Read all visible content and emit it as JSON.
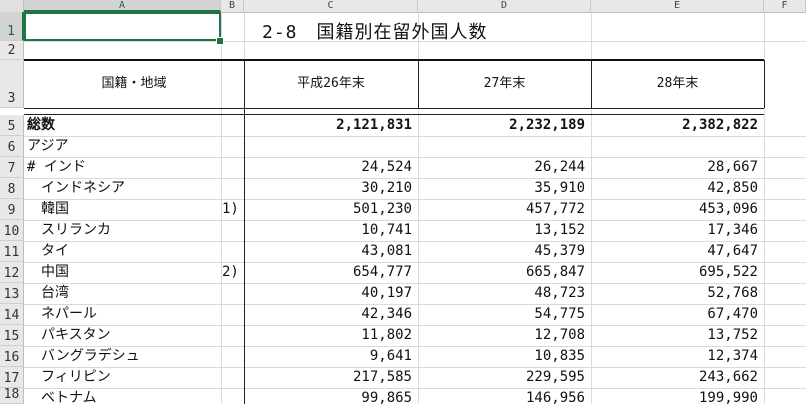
{
  "columns": [
    "A",
    "B",
    "C",
    "D",
    "E",
    "F"
  ],
  "rows": [
    "1",
    "2",
    "3",
    "5",
    "6",
    "7",
    "8",
    "9",
    "10",
    "11",
    "12",
    "13",
    "14",
    "15",
    "16",
    "17",
    "18"
  ],
  "title": "2-8　国籍別在留外国人数",
  "headers": {
    "region": "国籍・地域",
    "c": "平成26年末",
    "d": "27年末",
    "e": "28年末"
  },
  "data_rows": [
    {
      "label": "総数",
      "note": "",
      "c": "2,121,831",
      "d": "2,232,189",
      "e": "2,382,822",
      "bold": true
    },
    {
      "label": "アジア",
      "note": "",
      "c": "",
      "d": "",
      "e": ""
    },
    {
      "label": "# インド",
      "note": "",
      "c": "24,524",
      "d": "26,244",
      "e": "28,667"
    },
    {
      "label": "　インドネシア",
      "note": "",
      "c": "30,210",
      "d": "35,910",
      "e": "42,850"
    },
    {
      "label": "　韓国",
      "note": "1)",
      "c": "501,230",
      "d": "457,772",
      "e": "453,096"
    },
    {
      "label": "　スリランカ",
      "note": "",
      "c": "10,741",
      "d": "13,152",
      "e": "17,346"
    },
    {
      "label": "　タイ",
      "note": "",
      "c": "43,081",
      "d": "45,379",
      "e": "47,647"
    },
    {
      "label": "　中国",
      "note": "2)",
      "c": "654,777",
      "d": "665,847",
      "e": "695,522"
    },
    {
      "label": "　台湾",
      "note": "",
      "c": "40,197",
      "d": "48,723",
      "e": "52,768"
    },
    {
      "label": "　ネパール",
      "note": "",
      "c": "42,346",
      "d": "54,775",
      "e": "67,470"
    },
    {
      "label": "　パキスタン",
      "note": "",
      "c": "11,802",
      "d": "12,708",
      "e": "13,752"
    },
    {
      "label": "　バングラデシュ",
      "note": "",
      "c": "9,641",
      "d": "10,835",
      "e": "12,374"
    },
    {
      "label": "　フィリピン",
      "note": "",
      "c": "217,585",
      "d": "229,595",
      "e": "243,662"
    },
    {
      "label": "　ベトナム",
      "note": "",
      "c": "99,865",
      "d": "146,956",
      "e": "199,990"
    }
  ]
}
